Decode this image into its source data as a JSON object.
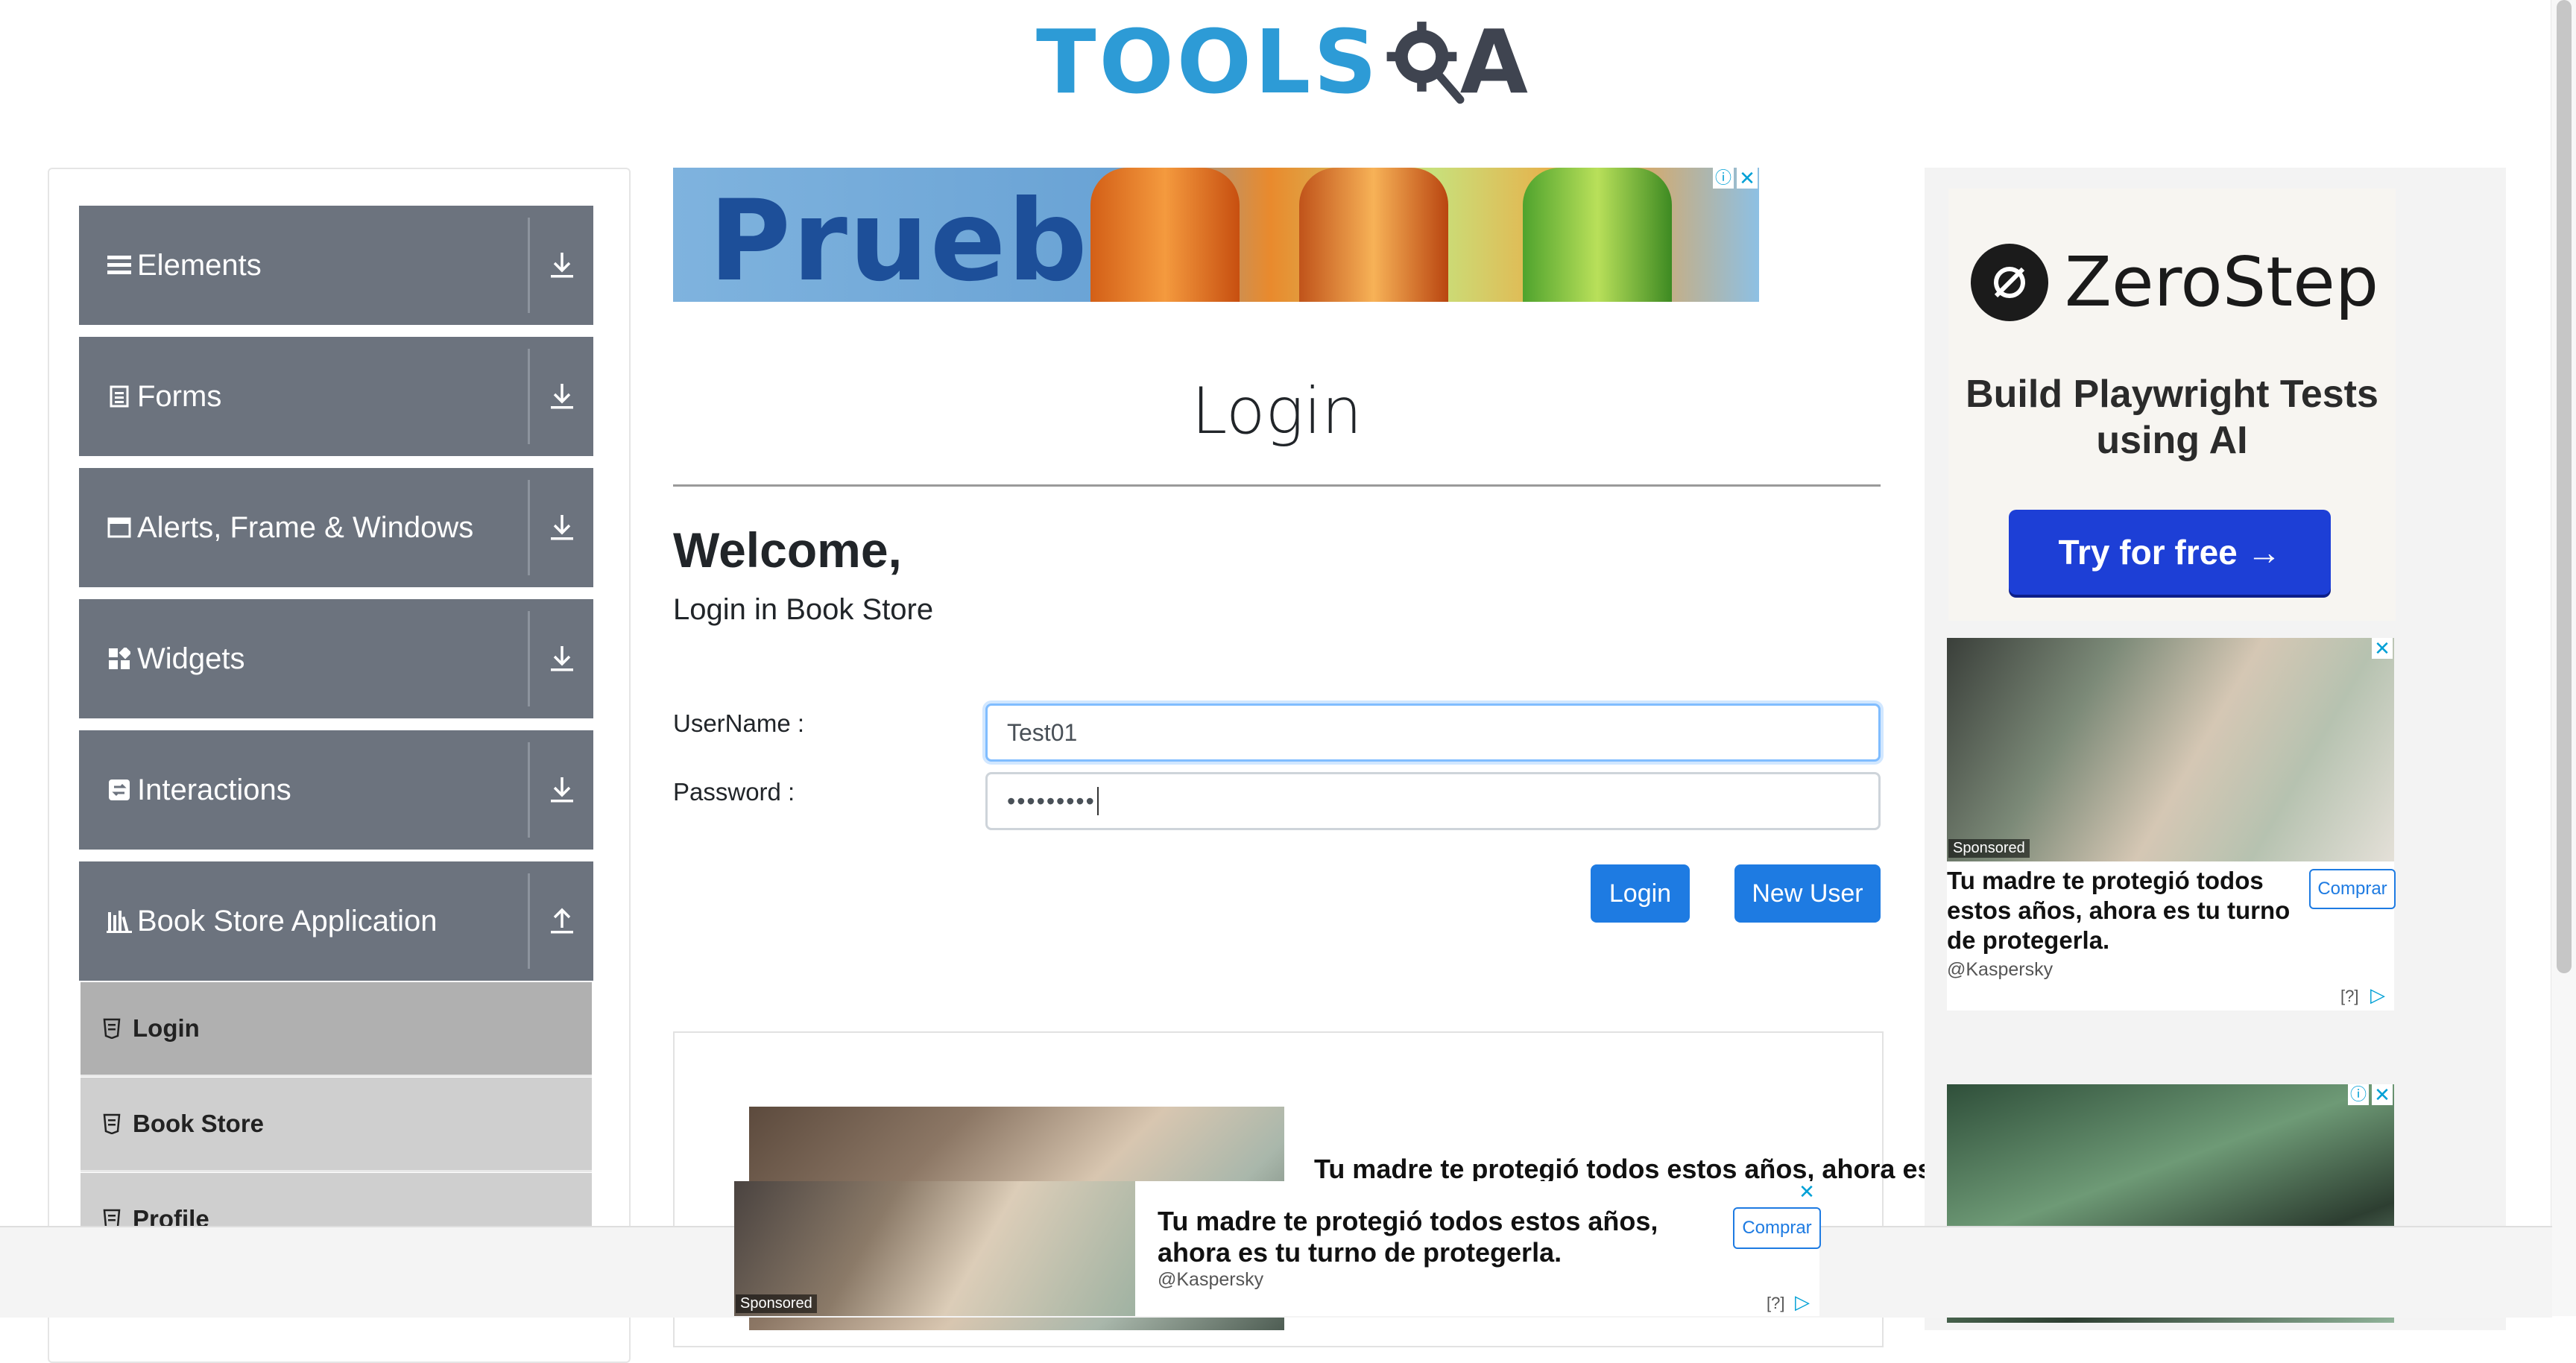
{
  "header": {
    "logo_text_left": "TOOLS",
    "logo_text_right": "A"
  },
  "sidebar": {
    "groups": [
      {
        "label": "Elements",
        "icon": "menu-icon",
        "toggle": "download-arrow-icon"
      },
      {
        "label": "Forms",
        "icon": "document-icon",
        "toggle": "download-arrow-icon"
      },
      {
        "label": "Alerts, Frame & Windows",
        "icon": "window-icon",
        "toggle": "download-arrow-icon"
      },
      {
        "label": "Widgets",
        "icon": "widgets-icon",
        "toggle": "download-arrow-icon"
      },
      {
        "label": "Interactions",
        "icon": "interactions-icon",
        "toggle": "download-arrow-icon"
      },
      {
        "label": "Book Store Application",
        "icon": "books-icon",
        "toggle": "upload-arrow-icon"
      }
    ],
    "book_store_items": [
      {
        "label": "Login",
        "active": true
      },
      {
        "label": "Book Store",
        "active": false
      },
      {
        "label": "Profile",
        "active": false
      }
    ]
  },
  "top_ad": {
    "text": "Prueba"
  },
  "main": {
    "title": "Login",
    "welcome": "Welcome,",
    "subtitle": "Login in Book Store",
    "username_label": "UserName :",
    "username_value": "Test01",
    "password_label": "Password :",
    "password_value": "•••••••••",
    "login_button": "Login",
    "new_user_button": "New User",
    "card_text": "Tu madre te protegió todos estos años, ahora es tu tur"
  },
  "right_ads": {
    "zerostep_brand": "ZeroStep",
    "zerostep_tagline": "Build Playwright Tests using AI",
    "zerostep_button": "Try for free →",
    "kaspersky_title": "Tu madre te protegió todos estos años, ahora es tu turno de protegerla.",
    "kaspersky_source": "@Kaspersky",
    "kaspersky_button": "Comprar",
    "sponsored": "Sponsored",
    "ad_help": "[?]"
  },
  "bottom_ad": {
    "title": "Tu madre te protegió todos estos años, ahora es tu turno de protegerla.",
    "source": "@Kaspersky",
    "button": "Comprar",
    "sponsored": "Sponsored",
    "ad_help": "[?]"
  },
  "colors": {
    "sidebar_group_bg": "#6c737e",
    "primary_button": "#1e7be2",
    "logo_blue": "#2d9bd6"
  }
}
